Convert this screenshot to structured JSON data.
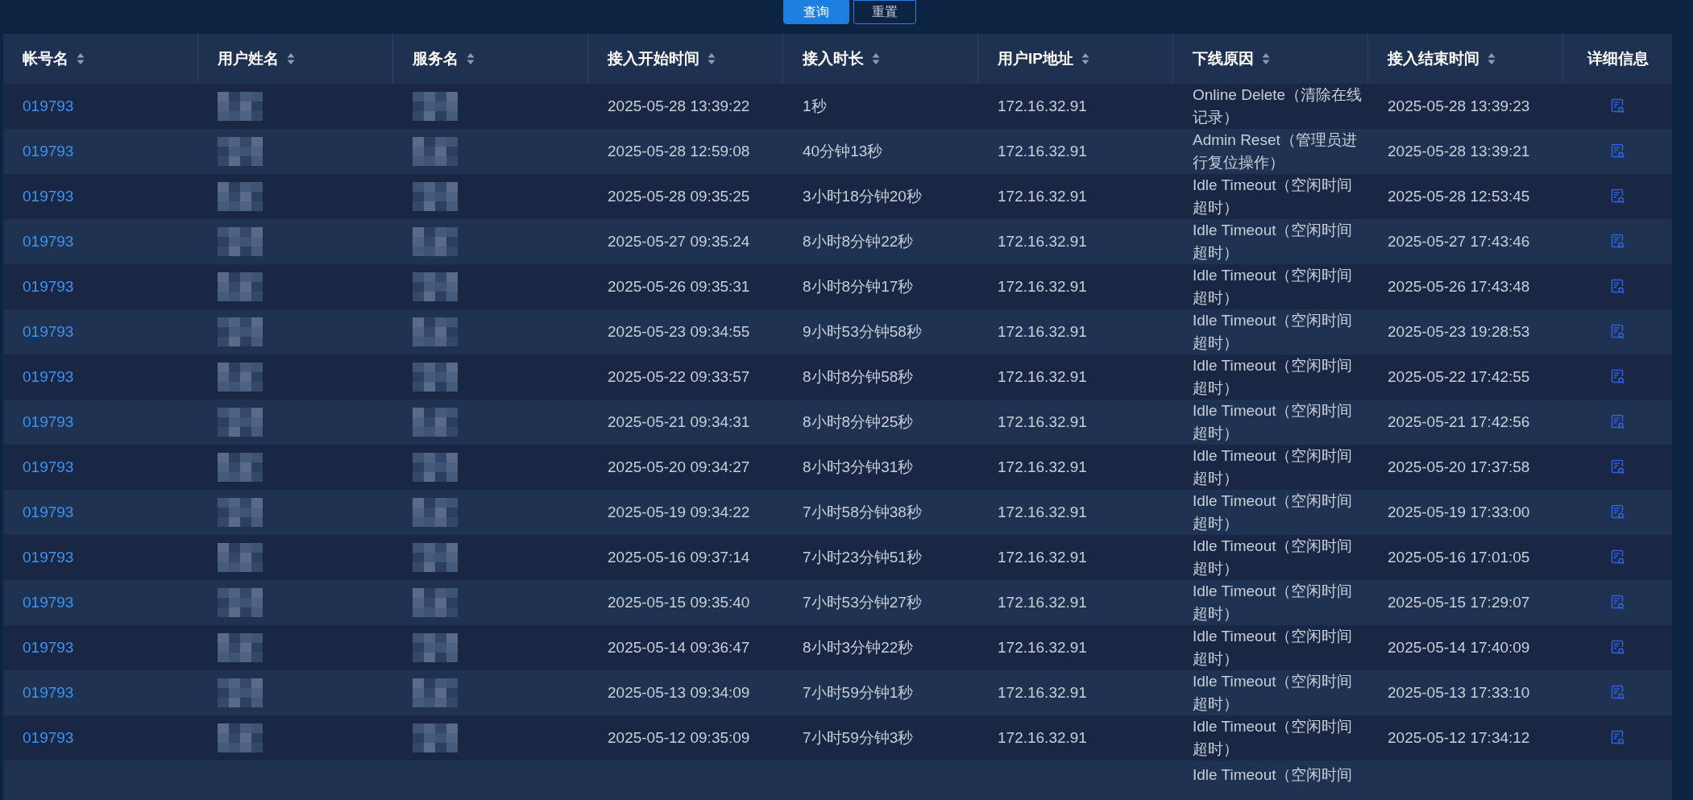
{
  "buttons": [
    {
      "label": "查询",
      "kind": "primary"
    },
    {
      "label": "重置",
      "kind": "outline"
    }
  ],
  "table": {
    "columns": [
      {
        "label": "帐号名",
        "sortable": true
      },
      {
        "label": "用户姓名",
        "sortable": true,
        "redacted": true
      },
      {
        "label": "服务名",
        "sortable": true,
        "redacted": true
      },
      {
        "label": "接入开始时间",
        "sortable": true
      },
      {
        "label": "接入时长",
        "sortable": true
      },
      {
        "label": "用户IP地址",
        "sortable": true
      },
      {
        "label": "下线原因",
        "sortable": true
      },
      {
        "label": "接入结束时间",
        "sortable": true
      },
      {
        "label": "详细信息",
        "sortable": false
      }
    ],
    "rows": [
      {
        "account": "019793",
        "start": "2025-05-28 13:39:22",
        "duration": "1秒",
        "ip": "172.16.32.91",
        "reason": "Online Delete（清除在线记录）",
        "end": "2025-05-28 13:39:23"
      },
      {
        "account": "019793",
        "start": "2025-05-28 12:59:08",
        "duration": "40分钟13秒",
        "ip": "172.16.32.91",
        "reason": "Admin Reset（管理员进行复位操作）",
        "end": "2025-05-28 13:39:21"
      },
      {
        "account": "019793",
        "start": "2025-05-28 09:35:25",
        "duration": "3小时18分钟20秒",
        "ip": "172.16.32.91",
        "reason": "Idle Timeout（空闲时间超时）",
        "end": "2025-05-28 12:53:45"
      },
      {
        "account": "019793",
        "start": "2025-05-27 09:35:24",
        "duration": "8小时8分钟22秒",
        "ip": "172.16.32.91",
        "reason": "Idle Timeout（空闲时间超时）",
        "end": "2025-05-27 17:43:46"
      },
      {
        "account": "019793",
        "start": "2025-05-26 09:35:31",
        "duration": "8小时8分钟17秒",
        "ip": "172.16.32.91",
        "reason": "Idle Timeout（空闲时间超时）",
        "end": "2025-05-26 17:43:48"
      },
      {
        "account": "019793",
        "start": "2025-05-23 09:34:55",
        "duration": "9小时53分钟58秒",
        "ip": "172.16.32.91",
        "reason": "Idle Timeout（空闲时间超时）",
        "end": "2025-05-23 19:28:53"
      },
      {
        "account": "019793",
        "start": "2025-05-22 09:33:57",
        "duration": "8小时8分钟58秒",
        "ip": "172.16.32.91",
        "reason": "Idle Timeout（空闲时间超时）",
        "end": "2025-05-22 17:42:55"
      },
      {
        "account": "019793",
        "start": "2025-05-21 09:34:31",
        "duration": "8小时8分钟25秒",
        "ip": "172.16.32.91",
        "reason": "Idle Timeout（空闲时间超时）",
        "end": "2025-05-21 17:42:56"
      },
      {
        "account": "019793",
        "start": "2025-05-20 09:34:27",
        "duration": "8小时3分钟31秒",
        "ip": "172.16.32.91",
        "reason": "Idle Timeout（空闲时间超时）",
        "end": "2025-05-20 17:37:58"
      },
      {
        "account": "019793",
        "start": "2025-05-19 09:34:22",
        "duration": "7小时58分钟38秒",
        "ip": "172.16.32.91",
        "reason": "Idle Timeout（空闲时间超时）",
        "end": "2025-05-19 17:33:00"
      },
      {
        "account": "019793",
        "start": "2025-05-16 09:37:14",
        "duration": "7小时23分钟51秒",
        "ip": "172.16.32.91",
        "reason": "Idle Timeout（空闲时间超时）",
        "end": "2025-05-16 17:01:05"
      },
      {
        "account": "019793",
        "start": "2025-05-15 09:35:40",
        "duration": "7小时53分钟27秒",
        "ip": "172.16.32.91",
        "reason": "Idle Timeout（空闲时间超时）",
        "end": "2025-05-15 17:29:07"
      },
      {
        "account": "019793",
        "start": "2025-05-14 09:36:47",
        "duration": "8小时3分钟22秒",
        "ip": "172.16.32.91",
        "reason": "Idle Timeout（空闲时间超时）",
        "end": "2025-05-14 17:40:09"
      },
      {
        "account": "019793",
        "start": "2025-05-13 09:34:09",
        "duration": "7小时59分钟1秒",
        "ip": "172.16.32.91",
        "reason": "Idle Timeout（空闲时间超时）",
        "end": "2025-05-13 17:33:10"
      },
      {
        "account": "019793",
        "start": "2025-05-12 09:35:09",
        "duration": "7小时59分钟3秒",
        "ip": "172.16.32.91",
        "reason": "Idle Timeout（空闲时间超时）",
        "end": "2025-05-12 17:34:12"
      },
      {
        "reason": "Idle Timeout（空闲时间"
      }
    ]
  }
}
